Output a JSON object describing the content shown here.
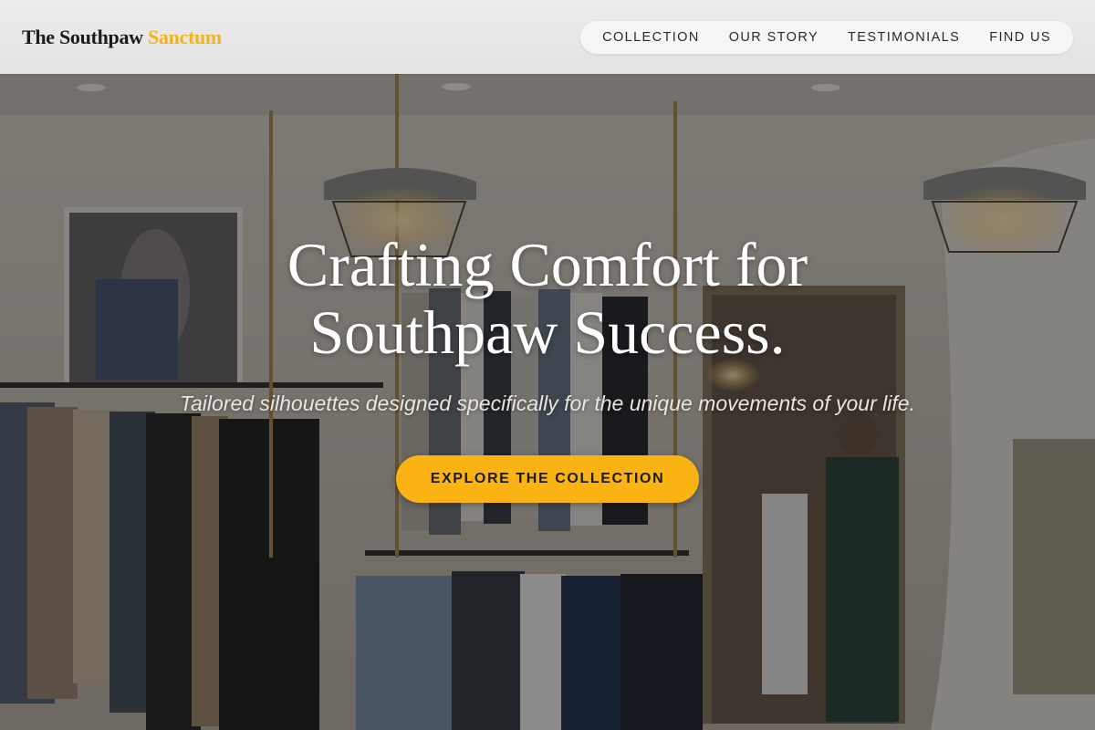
{
  "brand": {
    "name_main": "The Southpaw",
    "name_accent": "Sanctum",
    "accent_color": "#f5b21a"
  },
  "nav": {
    "items": [
      {
        "label": "COLLECTION"
      },
      {
        "label": "OUR STORY"
      },
      {
        "label": "TESTIMONIALS"
      },
      {
        "label": "FIND US"
      }
    ]
  },
  "hero": {
    "title_line1": "Crafting Comfort for",
    "title_line2": "Southpaw Success.",
    "subtitle": "Tailored silhouettes designed specifically for the unique movements of your life.",
    "cta_label": "EXPLORE THE COLLECTION",
    "cta_color": "#fbb313",
    "background_image": "clothing-store-interior-photo"
  }
}
